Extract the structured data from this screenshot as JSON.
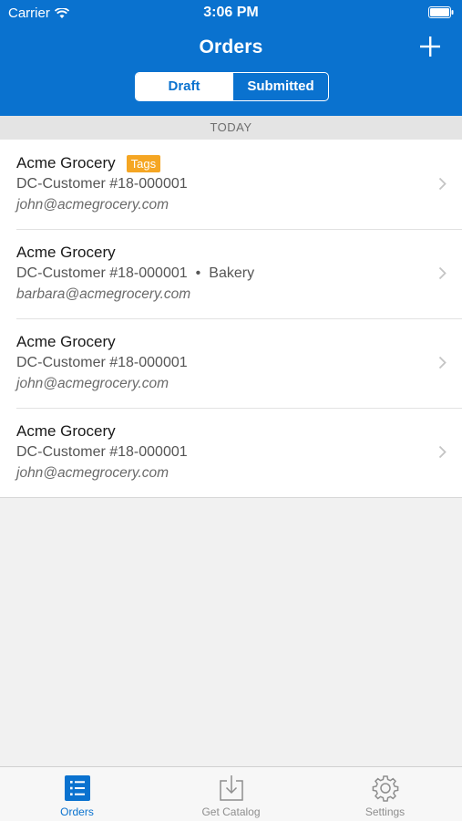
{
  "status_bar": {
    "carrier": "Carrier",
    "time": "3:06 PM"
  },
  "nav": {
    "title": "Orders",
    "add_icon": "plus-icon"
  },
  "segments": {
    "draft": "Draft",
    "submitted": "Submitted",
    "selected": "Draft"
  },
  "section": {
    "title": "TODAY"
  },
  "orders": [
    {
      "name": "Acme Grocery",
      "tag": "Tags",
      "customer": "DC-Customer #18-000001",
      "extra": "",
      "email": "john@acmegrocery.com"
    },
    {
      "name": "Acme Grocery",
      "tag": "",
      "customer": "DC-Customer #18-000001",
      "extra": "Bakery",
      "email": "barbara@acmegrocery.com"
    },
    {
      "name": "Acme Grocery",
      "tag": "",
      "customer": "DC-Customer #18-000001",
      "extra": "",
      "email": "john@acmegrocery.com"
    },
    {
      "name": "Acme Grocery",
      "tag": "",
      "customer": "DC-Customer #18-000001",
      "extra": "",
      "email": "john@acmegrocery.com"
    }
  ],
  "tabbar": {
    "orders": "Orders",
    "catalog": "Get Catalog",
    "settings": "Settings"
  },
  "colors": {
    "primary": "#0a72cf",
    "tag": "#f5a623"
  }
}
